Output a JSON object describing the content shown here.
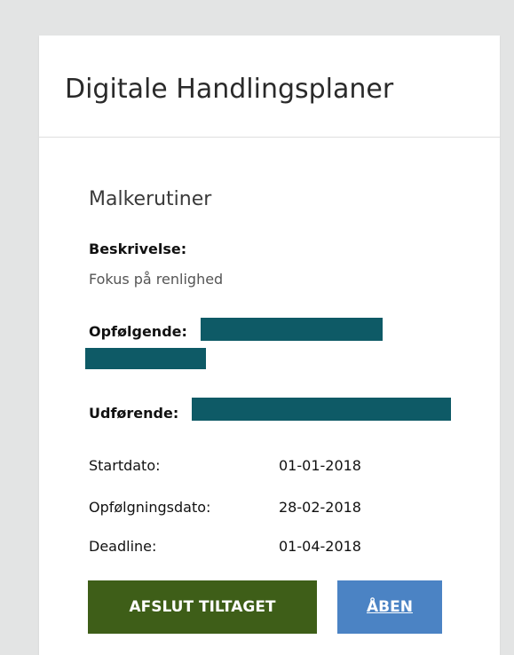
{
  "page": {
    "title": "Digitale Handlingsplaner"
  },
  "plan": {
    "title": "Malkerutiner",
    "description_label": "Beskrivelse:",
    "description": "Fokus på renlighed",
    "follow_up_label": "Opfølgende:",
    "executor_label": "Udførende:",
    "dates": [
      {
        "label": "Startdato:",
        "value": "01-01-2018"
      },
      {
        "label": "Opfølgningsdato:",
        "value": "28-02-2018"
      },
      {
        "label": "Deadline:",
        "value": "01-04-2018"
      }
    ]
  },
  "actions": {
    "close_label": "AFSLUT TILTAGET",
    "open_label": "ÅBEN"
  },
  "colors": {
    "close_button": "#3e5e18",
    "open_button": "#4b83c4",
    "redaction": "#0e5a66"
  }
}
